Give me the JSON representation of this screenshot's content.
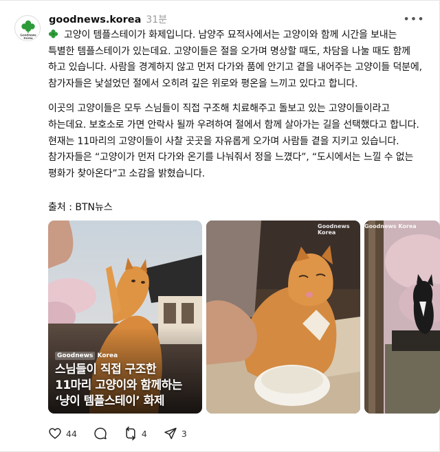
{
  "post": {
    "username": "goodnews.korea",
    "timestamp": "31분",
    "avatar_text": "Goodnews Korea",
    "paragraph1": "고양이 템플스테이가 화제입니다. 남양주 묘적사에서는 고양이와 함께 시간을 보내는 특별한 템플스테이가 있는데요. 고양이들은 절을 오가며 명상할 때도, 차담을 나눌 때도 함께 하고 있습니다. 사람을 경계하지 않고 먼저 다가와 품에 안기고 곁을 내어주는 고양이들 덕분에, 참가자들은 낯설었던 절에서 오히려 깊은 위로와 평온을 느끼고 있다고 합니다.",
    "paragraph2": "이곳의 고양이들은 모두 스님들이 직접 구조해 치료해주고 돌보고 있는 고양이들이라고 하는데요. 보호소로 가면 안락사 될까 우려하여 절에서 함께 살아가는 길을 선택했다고 합니다. 현재는 11마리의 고양이들이 사찰 곳곳을 자유롭게 오가며 사람들 곁을 지키고 있습니다. 참가자들은 “고양이가 먼저 다가와 온기를 나눠줘서 정을 느꼈다”, “도시에서는 느낄 수 없는 평화가 찾아온다”고 소감을 밝혔습니다.",
    "source": "출처 : BTN뉴스"
  },
  "media": {
    "brand_label": "Goodnews Korea",
    "brand_gn": "Goodnews",
    "brand_korea": "Korea",
    "card1_caption_line1": "스님들이 직접 구조한",
    "card1_caption_line2": "11마리 고양이와 함께하는",
    "card1_caption_line3": "‘냥이 템플스테이’ 화제"
  },
  "actions": {
    "like_count": "44",
    "repost_count": "4",
    "share_count": "3"
  },
  "icons": {
    "more": "more-horizontal-icon",
    "like": "heart-icon",
    "reply": "comment-icon",
    "repost": "repost-icon",
    "share": "send-icon",
    "clover": "four-leaf-clover-icon"
  },
  "colors": {
    "clover_green": "#2e9b3a",
    "text": "#101010",
    "muted": "#9a9a9a"
  }
}
